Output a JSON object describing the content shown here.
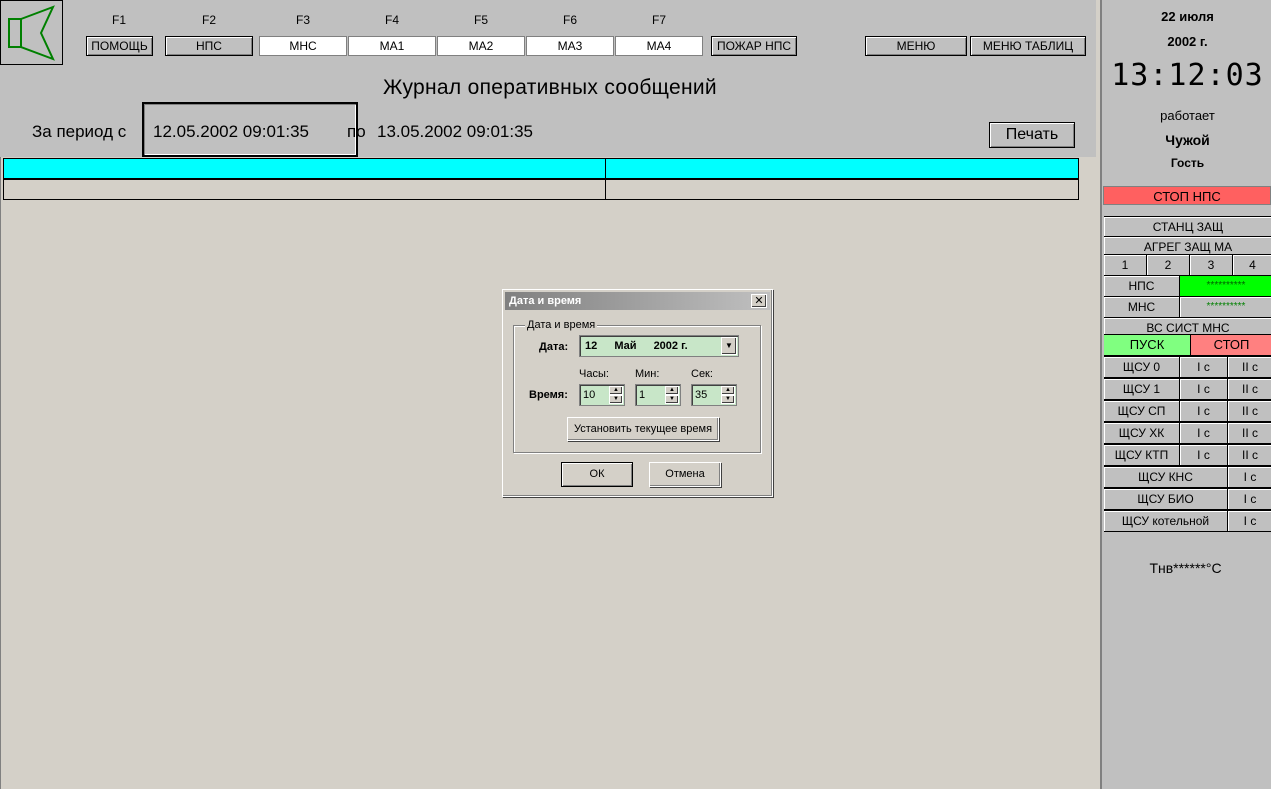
{
  "toolbar": {
    "fkeys": [
      "F1",
      "F2",
      "F3",
      "F4",
      "F5",
      "F6",
      "F7"
    ],
    "buttons": [
      "ПОМОЩЬ",
      "НПС",
      "МНС",
      "МА1",
      "МА2",
      "МА3",
      "МА4"
    ],
    "fire_label": "ПОЖАР НПС",
    "menu_label": "МЕНЮ",
    "menu_tables_label": "МЕНЮ ТАБЛИЦ"
  },
  "page": {
    "title": "Журнал оперативных сообщений",
    "period_label": "За период с",
    "period_from": "12.05.2002 09:01:35",
    "period_to_label": "по",
    "period_to": "13.05.2002 09:01:35",
    "print_label": "Печать"
  },
  "side": {
    "date": "22 июля",
    "year": "2002 г.",
    "time": "13:12:03",
    "status": "работает",
    "user": "Чужой",
    "role": "Гость",
    "stop_nps": "СТОП НПС",
    "station_protect": "СТАНЦ ЗАЩ",
    "agreg_protect": "АГРЕГ ЗАЩ МА",
    "agreg_nums": [
      "1",
      "2",
      "3",
      "4"
    ],
    "nps_label": "НПС",
    "nps_value": "**********",
    "mns_label": "МНС",
    "mns_value": "**********",
    "vs_sist": "ВС СИСТ МНС",
    "start_label": "ПУСК",
    "stop_label": "СТОП",
    "shsu_rows": [
      {
        "name": "ЩСУ 0",
        "c1": "I с",
        "c2": "II с"
      },
      {
        "name": "ЩСУ 1",
        "c1": "I с",
        "c2": "II с"
      },
      {
        "name": "ЩСУ СП",
        "c1": "I с",
        "c2": "II с"
      },
      {
        "name": "ЩСУ ХК",
        "c1": "I с",
        "c2": "II с"
      },
      {
        "name": "ЩСУ КТП",
        "c1": "I с",
        "c2": "II с"
      }
    ],
    "shsu_single": [
      {
        "name": "ЩСУ КНС",
        "c1": "I с"
      },
      {
        "name": "ЩСУ БИО",
        "c1": "I с"
      },
      {
        "name": "ЩСУ котельной",
        "c1": "I с"
      }
    ],
    "temp": "Тнв******°С"
  },
  "dialog": {
    "title": "Дата и время",
    "group_label": "Дата и время",
    "date_label": "Дата:",
    "date_day": "12",
    "date_month": "Май",
    "date_year": "2002 г.",
    "time_label": "Время:",
    "hours_label": "Часы:",
    "minutes_label": "Мин:",
    "seconds_label": "Сек:",
    "hours": "10",
    "minutes": "1",
    "seconds": "35",
    "set_now_label": "Установить текущее время",
    "ok_label": "ОК",
    "cancel_label": "Отмена"
  },
  "colors": {
    "grid_header": "#00ffff",
    "stop_red": "#ff6060",
    "start_green": "#80ff80",
    "nps_green": "#00ff00",
    "field_green": "#c8e6c8"
  }
}
